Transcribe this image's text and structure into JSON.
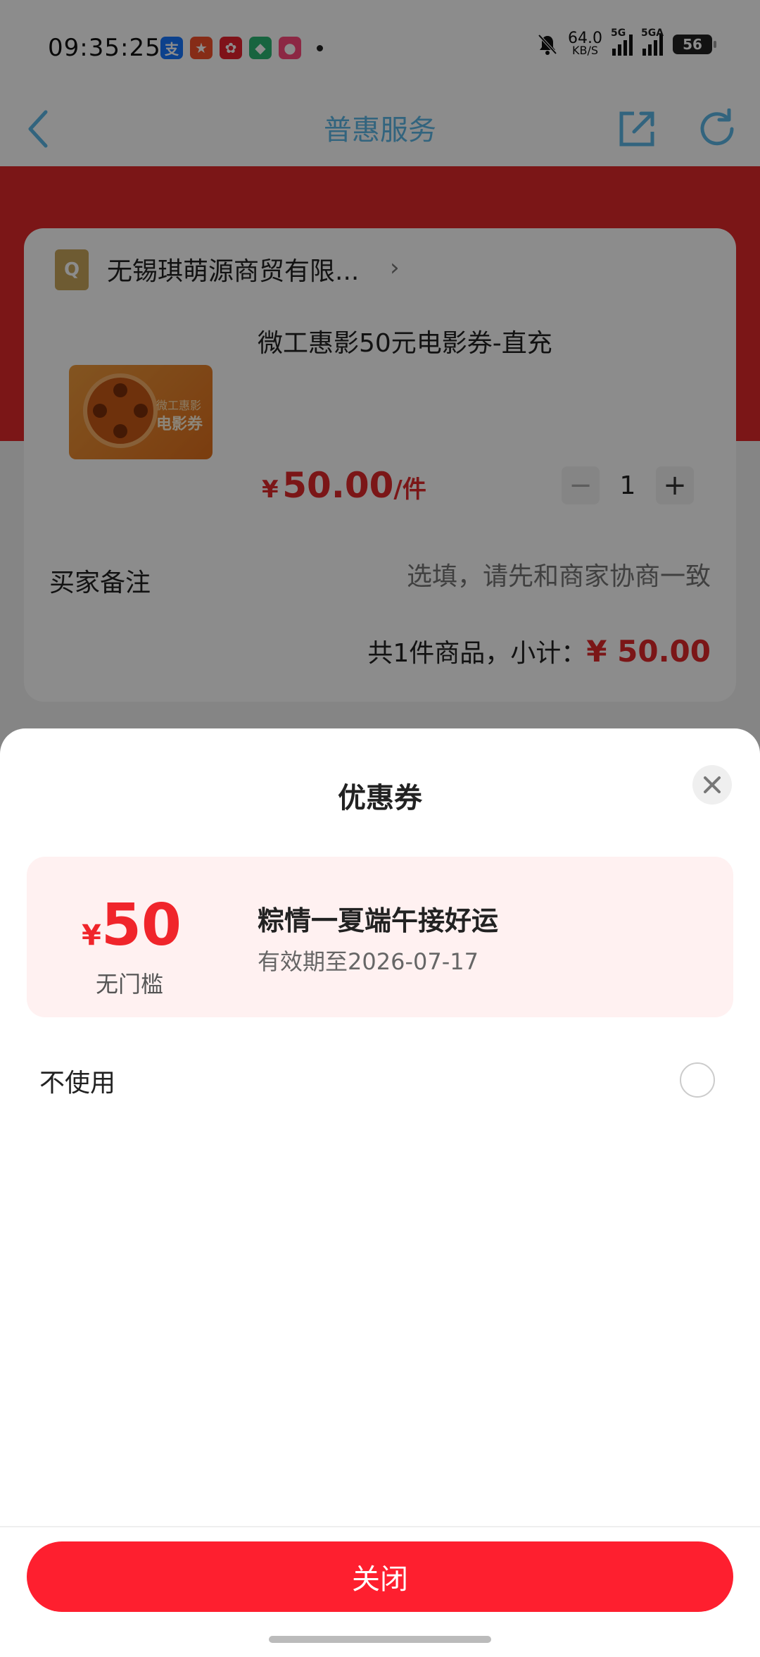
{
  "status_bar": {
    "time": "09:35:25",
    "net_speed_value": "64.0",
    "net_speed_unit": "KB/S",
    "sim1_label": "5G",
    "sim2_label": "5GA",
    "battery": "56",
    "app_icons": [
      "alipay-icon",
      "app-icon-2",
      "app-icon-3",
      "app-icon-4",
      "app-icon-5"
    ]
  },
  "header": {
    "title": "普惠服务"
  },
  "order": {
    "shop_name": "无锡琪萌源商贸有限...",
    "product_title": "微工惠影50元电影券-直充",
    "product_image_text_small": "微工惠影",
    "product_image_text_large": "电影券",
    "price_symbol": "¥",
    "price_value": "50.00",
    "price_unit": "/件",
    "quantity": "1",
    "minus": "−",
    "plus": "+",
    "note_label": "买家备注",
    "note_placeholder": "选填，请先和商家协商一致",
    "subtotal_label": "共1件商品，小计：",
    "subtotal_amount": "¥ 50.00"
  },
  "sheet": {
    "title": "优惠券",
    "coupon": {
      "currency": "¥",
      "amount": "50",
      "condition": "无门槛",
      "name": "粽情一夏端午接好运",
      "expiry": "有效期至2026-07-17"
    },
    "no_use_label": "不使用",
    "close_button": "关闭"
  },
  "colors": {
    "accent_red": "#fe1f2f",
    "price_red": "#e0282a",
    "header_blue": "#5bb7e5",
    "coupon_bg": "#fff1f1"
  }
}
